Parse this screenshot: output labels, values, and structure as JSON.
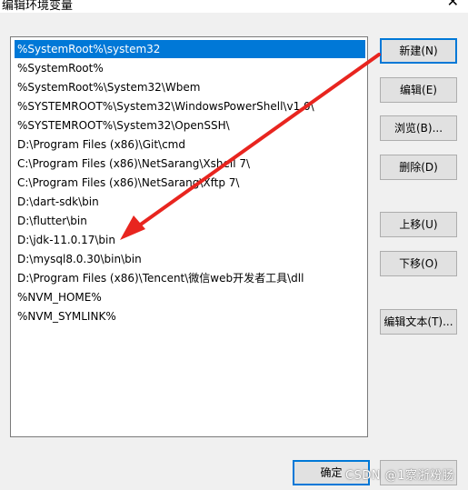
{
  "window": {
    "title": "编辑环境变量",
    "close_glyph": "✕"
  },
  "list": {
    "items": [
      "%SystemRoot%\\system32",
      "%SystemRoot%",
      "%SystemRoot%\\System32\\Wbem",
      "%SYSTEMROOT%\\System32\\WindowsPowerShell\\v1.0\\",
      "%SYSTEMROOT%\\System32\\OpenSSH\\",
      "D:\\Program Files (x86)\\Git\\cmd",
      "C:\\Program Files (x86)\\NetSarang\\Xshell 7\\",
      "C:\\Program Files (x86)\\NetSarang\\Xftp 7\\",
      "D:\\dart-sdk\\bin",
      "D:\\flutter\\bin",
      "D:\\jdk-11.0.17\\bin",
      "D:\\mysql8.0.30\\bin\\bin",
      "D:\\Program Files (x86)\\Tencent\\微信web开发者工具\\dll",
      "%NVM_HOME%",
      "%NVM_SYMLINK%"
    ],
    "selected_index": 0
  },
  "buttons": {
    "new": "新建(N)",
    "edit": "编辑(E)",
    "browse": "浏览(B)...",
    "delete": "删除(D)",
    "move_up": "上移(U)",
    "move_down": "下移(O)",
    "edit_text": "编辑文本(T)...",
    "ok": "确定"
  },
  "annotation": {
    "arrow_color": "#e8251f"
  },
  "watermark": "CSDN @1察浙粉肠",
  "colors": {
    "selection": "#0078d7",
    "focus_border": "#0078d7"
  }
}
